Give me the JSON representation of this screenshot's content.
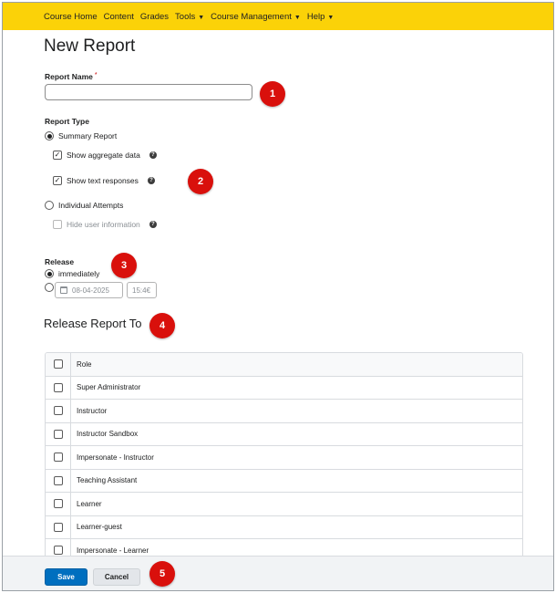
{
  "nav": {
    "items": [
      {
        "label": "Course Home",
        "dropdown": false
      },
      {
        "label": "Content",
        "dropdown": false
      },
      {
        "label": "Grades",
        "dropdown": false
      },
      {
        "label": "Tools",
        "dropdown": true
      },
      {
        "label": "Course Management",
        "dropdown": true
      },
      {
        "label": "Help",
        "dropdown": true
      }
    ]
  },
  "page": {
    "title": "New Report"
  },
  "form": {
    "report_name_label": "Report Name",
    "report_name_required": "*",
    "report_name_value": "",
    "report_type_label": "Report Type",
    "summary_report": "Summary Report",
    "show_aggregate": "Show aggregate data",
    "show_text": "Show text responses",
    "individual_attempts": "Individual Attempts",
    "hide_user_info": "Hide user information",
    "release_label": "Release",
    "release_immediately": "immediately",
    "release_date": "08-04-2025",
    "release_time": "15:4€"
  },
  "release_to": {
    "title": "Release Report To",
    "header": "Role",
    "roles": [
      "Super Administrator",
      "Instructor",
      "Instructor Sandbox",
      "Impersonate - Instructor",
      "Teaching Assistant",
      "Learner",
      "Learner-guest",
      "Impersonate - Learner"
    ]
  },
  "footer": {
    "save": "Save",
    "cancel": "Cancel"
  },
  "callouts": [
    "1",
    "2",
    "3",
    "4",
    "5"
  ],
  "colors": {
    "nav_bg": "#fbd208",
    "primary": "#006fbf",
    "callout": "#d9100c"
  },
  "icons": {
    "help": "help-icon",
    "calendar": "calendar-icon",
    "chevron": "chevron-down-icon"
  }
}
